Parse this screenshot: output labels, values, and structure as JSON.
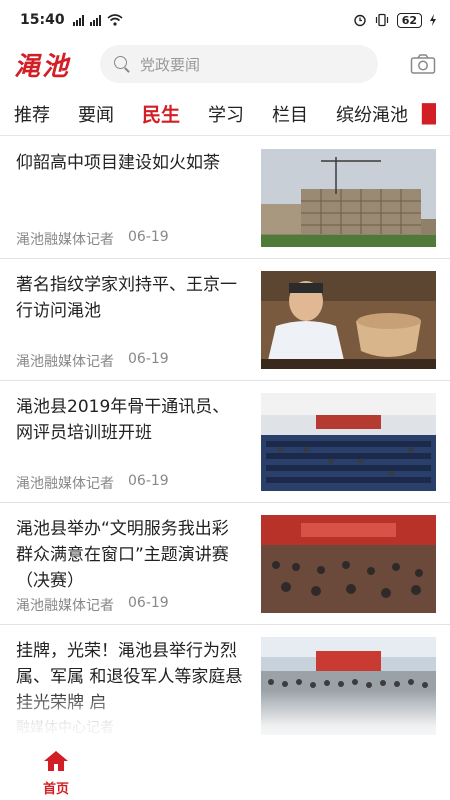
{
  "status": {
    "time": "15:40",
    "left_icons": [
      "signal-icon",
      "signal-icon",
      "wifi-icon"
    ],
    "right_icons": [
      "alarm-icon",
      "vibrate-icon"
    ],
    "battery": "62"
  },
  "header": {
    "logo": "渑池",
    "search_placeholder": "党政要闻",
    "camera_icon": "camera-icon"
  },
  "tabs": [
    {
      "label": "推荐",
      "active": false
    },
    {
      "label": "要闻",
      "active": false
    },
    {
      "label": "民生",
      "active": true
    },
    {
      "label": "学习",
      "active": false
    },
    {
      "label": "栏目",
      "active": false
    },
    {
      "label": "缤纷渑池",
      "active": false
    }
  ],
  "feed": [
    {
      "title": "仰韶高中项目建设如火如荼",
      "author": "渑池融媒体记者",
      "date": "06-19",
      "thumb": "construction-site-photo"
    },
    {
      "title": "著名指纹学家刘持平、王京一行访问渑池",
      "author": "渑池融媒体记者",
      "date": "06-19",
      "thumb": "man-with-pottery-photo"
    },
    {
      "title": "渑池县2019年骨干通讯员、网评员培训班开班",
      "author": "渑池融媒体记者",
      "date": "06-19",
      "thumb": "auditorium-meeting-photo"
    },
    {
      "title": "渑池县举办“文明服务我出彩 群众满意在窗口”主题演讲赛（决赛）",
      "author": "渑池融媒体记者",
      "date": "06-19",
      "thumb": "speech-contest-photo"
    },
    {
      "title": "挂牌，光荣！渑池县举行为烈属、军属 和退役军人等家庭悬挂光荣牌 启",
      "author": "融媒体中心记者",
      "date": "",
      "thumb": "outdoor-ceremony-photo"
    }
  ],
  "bottom_nav": {
    "home_label": "首页",
    "home_icon": "home-icon",
    "accent": "#d21f25"
  }
}
